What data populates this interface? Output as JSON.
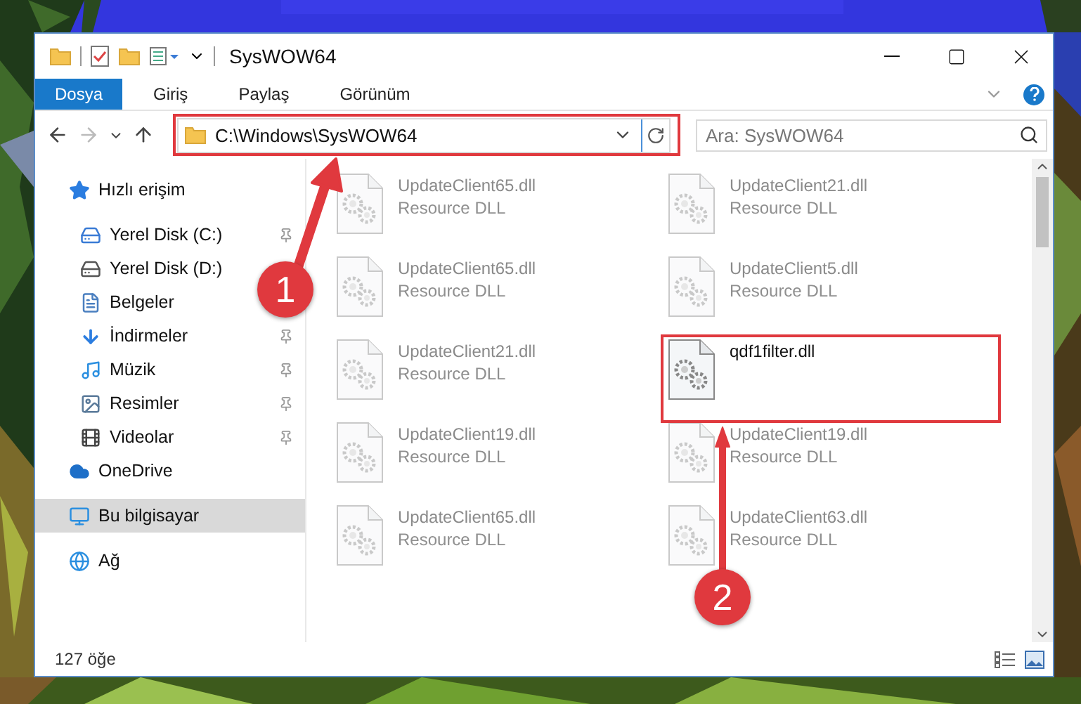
{
  "window": {
    "title": "SysWOW64"
  },
  "ribbon_tabs": [
    {
      "label": "Dosya",
      "selected": true
    },
    {
      "label": "Giriş",
      "selected": false
    },
    {
      "label": "Paylaş",
      "selected": false
    },
    {
      "label": "Görünüm",
      "selected": false
    }
  ],
  "address": {
    "path": "C:\\Windows\\SysWOW64"
  },
  "search": {
    "placeholder": "Ara: SysWOW64"
  },
  "sidebar": {
    "items": [
      {
        "label": "Hızlı erişim",
        "kind": "star",
        "selected": false,
        "pinned": false,
        "children": [
          {
            "label": "Yerel Disk (C:)",
            "kind": "system-drive",
            "selected": false,
            "pinned": true
          },
          {
            "label": "Yerel Disk (D:)",
            "kind": "drive",
            "selected": false,
            "pinned": false
          },
          {
            "label": "Belgeler",
            "kind": "document",
            "selected": false,
            "pinned": false
          },
          {
            "label": "İndirmeler",
            "kind": "download",
            "selected": false,
            "pinned": true
          },
          {
            "label": "Müzik",
            "kind": "music",
            "selected": false,
            "pinned": true
          },
          {
            "label": "Resimler",
            "kind": "pictures",
            "selected": false,
            "pinned": true
          },
          {
            "label": "Videolar",
            "kind": "video",
            "selected": false,
            "pinned": true
          }
        ]
      },
      {
        "label": "OneDrive",
        "kind": "cloud",
        "selected": false,
        "pinned": false
      },
      {
        "label": "Bu bilgisayar",
        "kind": "computer",
        "selected": true,
        "pinned": false
      },
      {
        "label": "Ağ",
        "kind": "network",
        "selected": false,
        "pinned": false
      }
    ]
  },
  "files": [
    {
      "name": "UpdateClient65.dll",
      "type": "Resource DLL",
      "blurred": true
    },
    {
      "name": "UpdateClient21.dll",
      "type": "Resource DLL",
      "blurred": true
    },
    {
      "name": "UpdateClient65.dll",
      "type": "Resource DLL",
      "blurred": true
    },
    {
      "name": "UpdateClient5.dll",
      "type": "Resource DLL",
      "blurred": true
    },
    {
      "name": "UpdateClient21.dll",
      "type": "Resource DLL",
      "blurred": true
    },
    {
      "name": "qdf1filter.dll",
      "blurred": false
    },
    {
      "name": "UpdateClient19.dll",
      "type": "Resource DLL",
      "blurred": true
    },
    {
      "name": "UpdateClient19.dll",
      "type": "Resource DLL",
      "blurred": true
    },
    {
      "name": "UpdateClient65.dll",
      "type": "Resource DLL",
      "blurred": true
    },
    {
      "name": "UpdateClient63.dll",
      "type": "Resource DLL",
      "blurred": true
    }
  ],
  "status_bar": {
    "count": "127 öğe"
  },
  "annotations": [
    {
      "label": "1"
    },
    {
      "label": "2"
    }
  ]
}
